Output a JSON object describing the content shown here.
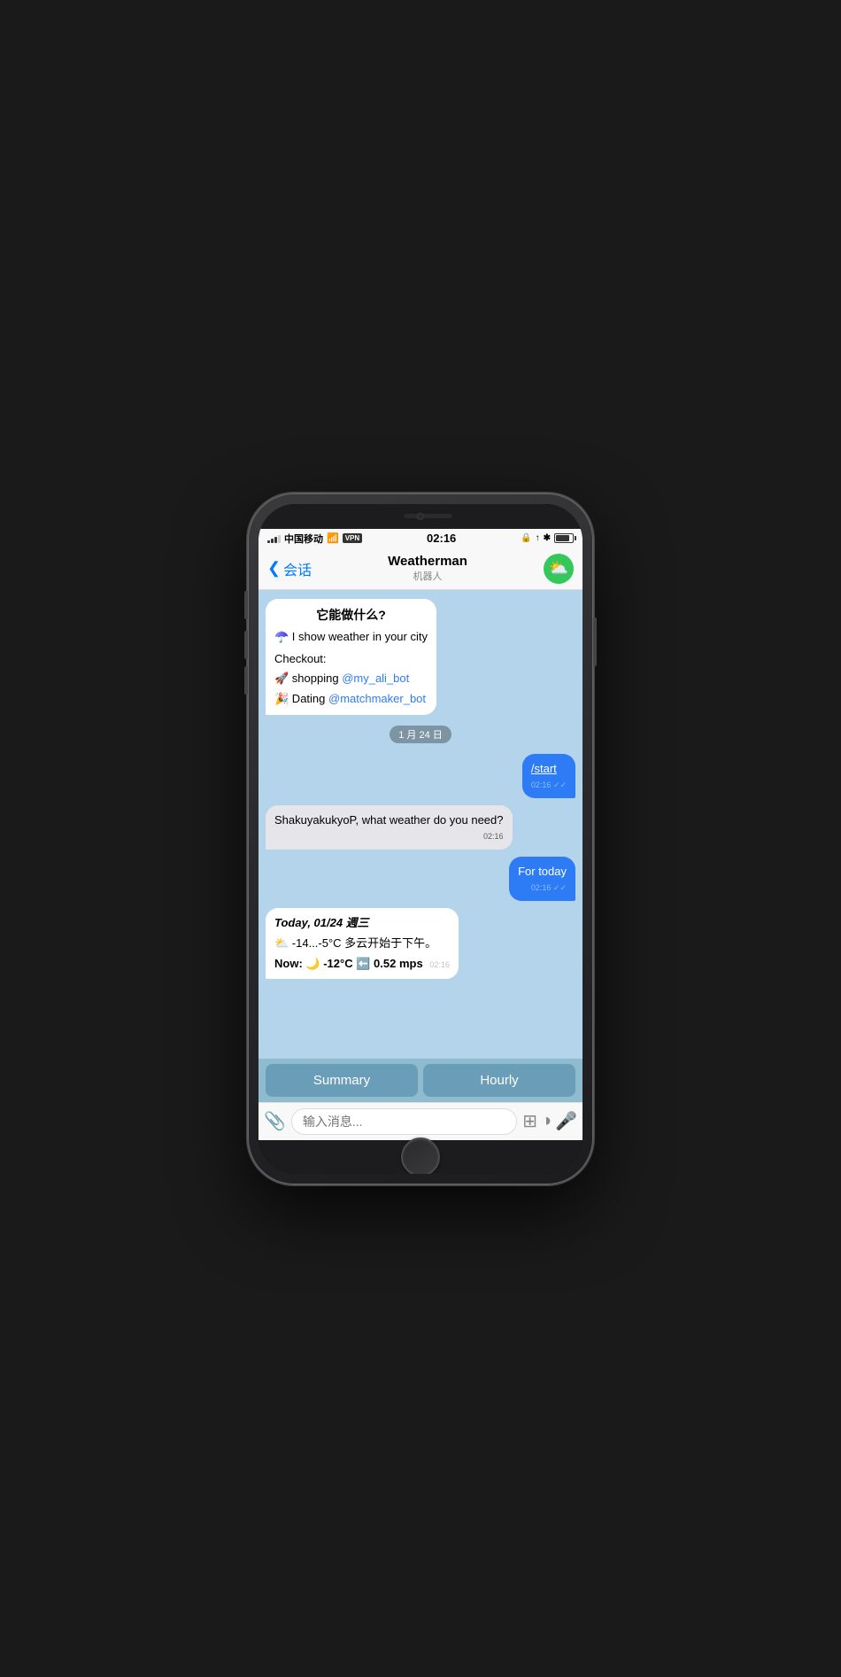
{
  "phone": {
    "status_bar": {
      "carrier": "中国移动",
      "wifi": "WiFi",
      "vpn": "VPN",
      "time": "02:16",
      "battery_pct": 85
    },
    "nav": {
      "back_label": "会话",
      "title": "Weatherman",
      "subtitle": "机器人"
    },
    "chat": {
      "intro_bubble": {
        "heading": "它能做什么?",
        "line1_emoji": "☂️",
        "line1_text": " I show weather in your city",
        "checkout_label": "Checkout:",
        "shopping_emoji": "🚀",
        "shopping_text": " shopping ",
        "shopping_link": "@my_ali_bot",
        "dating_emoji": "🎉",
        "dating_text": " Dating ",
        "dating_link": "@matchmaker_bot"
      },
      "date_chip": "1 月 24 日",
      "msg_start": "/start",
      "msg_start_time": "02:16",
      "msg_bot_response": "ShakuyakukyoP, what weather do you need?",
      "msg_bot_response_time": "02:16",
      "msg_for_today": "For today",
      "msg_for_today_time": "02:16",
      "weather_bubble": {
        "date_line": "Today, 01/24 週三",
        "temp_range_emoji": "⛅",
        "temp_range_text": " -14...-5°C 多云开始于下午。",
        "now_label": "Now:",
        "now_emoji": "🌙",
        "now_temp": " -12°C ",
        "arrow_emoji": "⬅️",
        "now_wind": " 0.52 mps",
        "time": "02:16"
      },
      "btn_summary": "Summary",
      "btn_hourly": "Hourly",
      "input_placeholder": "输入消息..."
    }
  }
}
